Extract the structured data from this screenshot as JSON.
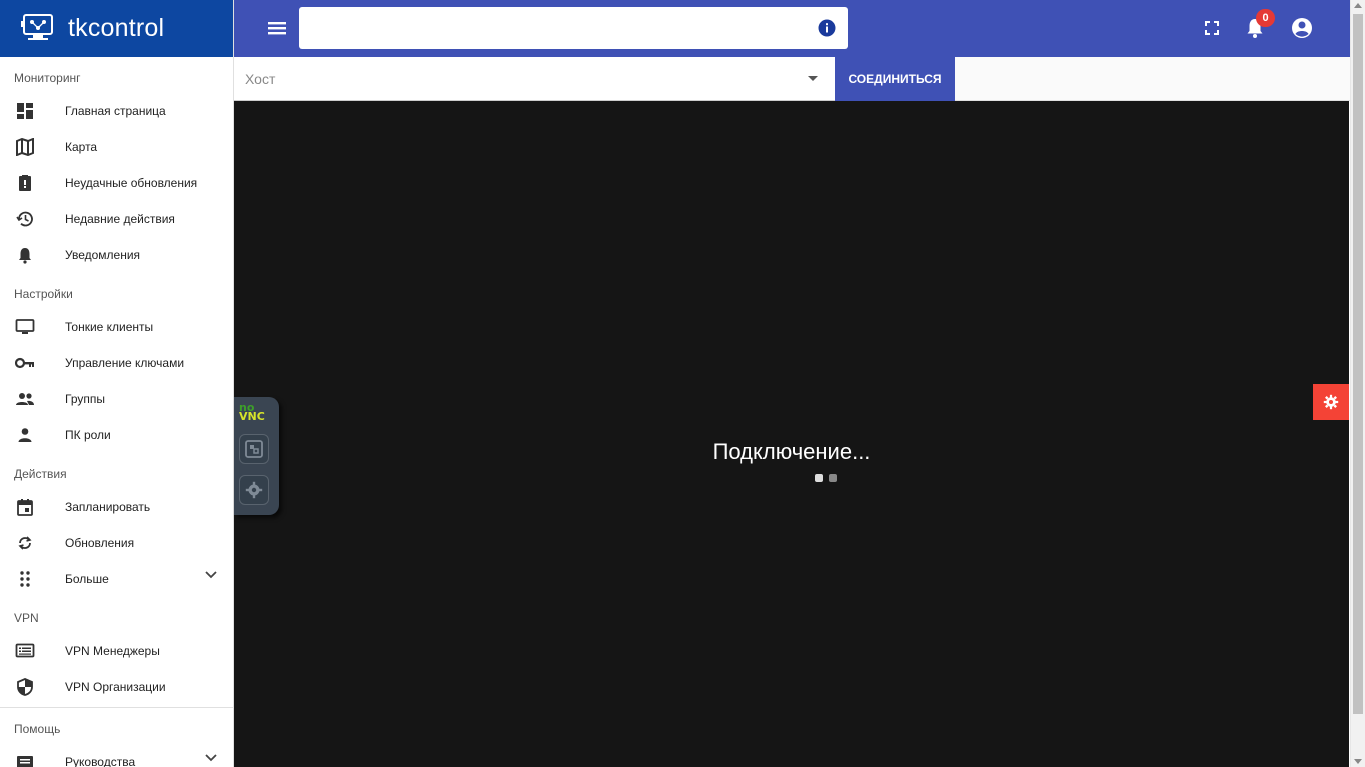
{
  "app": {
    "name": "tkcontrol",
    "logo": "monitor-network-logo"
  },
  "sidebar": {
    "sections": [
      {
        "title": "Мониторинг",
        "items": [
          {
            "label": "Главная страница",
            "icon": "dashboard-icon"
          },
          {
            "label": "Карта",
            "icon": "map-icon"
          },
          {
            "label": "Неудачные обновления",
            "icon": "clipboard-alert-icon"
          },
          {
            "label": "Недавние действия",
            "icon": "history-icon"
          },
          {
            "label": "Уведомления",
            "icon": "bell-icon"
          }
        ]
      },
      {
        "title": "Настройки",
        "items": [
          {
            "label": "Тонкие клиенты",
            "icon": "monitor-icon"
          },
          {
            "label": "Управление ключами",
            "icon": "key-icon"
          },
          {
            "label": "Группы",
            "icon": "group-icon"
          },
          {
            "label": "ПК роли",
            "icon": "person-icon"
          }
        ]
      },
      {
        "title": "Действия",
        "items": [
          {
            "label": "Запланировать",
            "icon": "calendar-icon"
          },
          {
            "label": "Обновления",
            "icon": "sync-icon"
          },
          {
            "label": "Больше",
            "icon": "dots-grid-icon",
            "expandable": true
          }
        ]
      },
      {
        "title": "VPN",
        "items": [
          {
            "label": "VPN Менеджеры",
            "icon": "list-icon"
          },
          {
            "label": "VPN Организации",
            "icon": "shield-icon"
          }
        ]
      },
      {
        "title": "Помощь",
        "items": [
          {
            "label": "Руководства",
            "icon": "book-icon",
            "expandable": true
          }
        ]
      }
    ]
  },
  "topbar": {
    "search_value": "",
    "notifications_count": "0",
    "icons": [
      "menu-icon",
      "info-icon",
      "fullscreen-icon",
      "bell-icon",
      "account-icon"
    ]
  },
  "hostbar": {
    "placeholder": "Хост",
    "connect_label": "СОЕДИНИТЬСЯ"
  },
  "vnc": {
    "logo_top": "no",
    "logo_bottom": "VNC",
    "status": "Подключение..."
  },
  "colors": {
    "brand": "#0d47a1",
    "primary": "#3f51b5",
    "badge": "#e53935",
    "gear": "#f44336",
    "canvas": "#151515"
  }
}
